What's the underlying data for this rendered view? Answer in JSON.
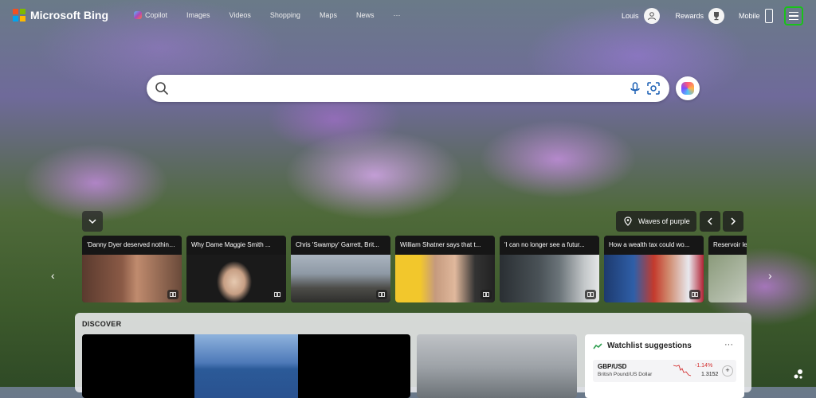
{
  "brand": {
    "name": "Microsoft Bing"
  },
  "nav": {
    "items": [
      {
        "label": "Copilot"
      },
      {
        "label": "Images"
      },
      {
        "label": "Videos"
      },
      {
        "label": "Shopping"
      },
      {
        "label": "Maps"
      },
      {
        "label": "News"
      },
      {
        "label": "···"
      }
    ]
  },
  "account": {
    "user": "Louis",
    "rewards_label": "Rewards",
    "mobile_label": "Mobile"
  },
  "search": {
    "placeholder": "",
    "value": ""
  },
  "background": {
    "caption": "Waves of purple"
  },
  "news": [
    {
      "title": "'Danny Dyer deserved nothing...'"
    },
    {
      "title": "Why Dame Maggie Smith ..."
    },
    {
      "title": "Chris 'Swampy' Garrett, Brit..."
    },
    {
      "title": "William Shatner says that t..."
    },
    {
      "title": "'I can no longer see a futur..."
    },
    {
      "title": "How a wealth tax could wo..."
    },
    {
      "title": "Reservoir le..."
    }
  ],
  "discover": {
    "title": "DISCOVER",
    "watchlist": {
      "title": "Watchlist suggestions",
      "more": "···",
      "rows": [
        {
          "symbol": "GBP/USD",
          "name": "British Pound/US Dollar",
          "change": "-1.14%",
          "price": "1.3152",
          "add": "+"
        }
      ]
    }
  },
  "colors": {
    "accent_green": "#19c219",
    "negative": "#d32f2f",
    "search_bg": "#ffffff"
  },
  "icons": [
    "search-icon",
    "microphone-icon",
    "visual-search-icon",
    "copilot-icon",
    "menu-icon",
    "location-pin-icon",
    "chevron-left-icon",
    "chevron-right-icon",
    "chevron-down-icon",
    "read-icon"
  ]
}
